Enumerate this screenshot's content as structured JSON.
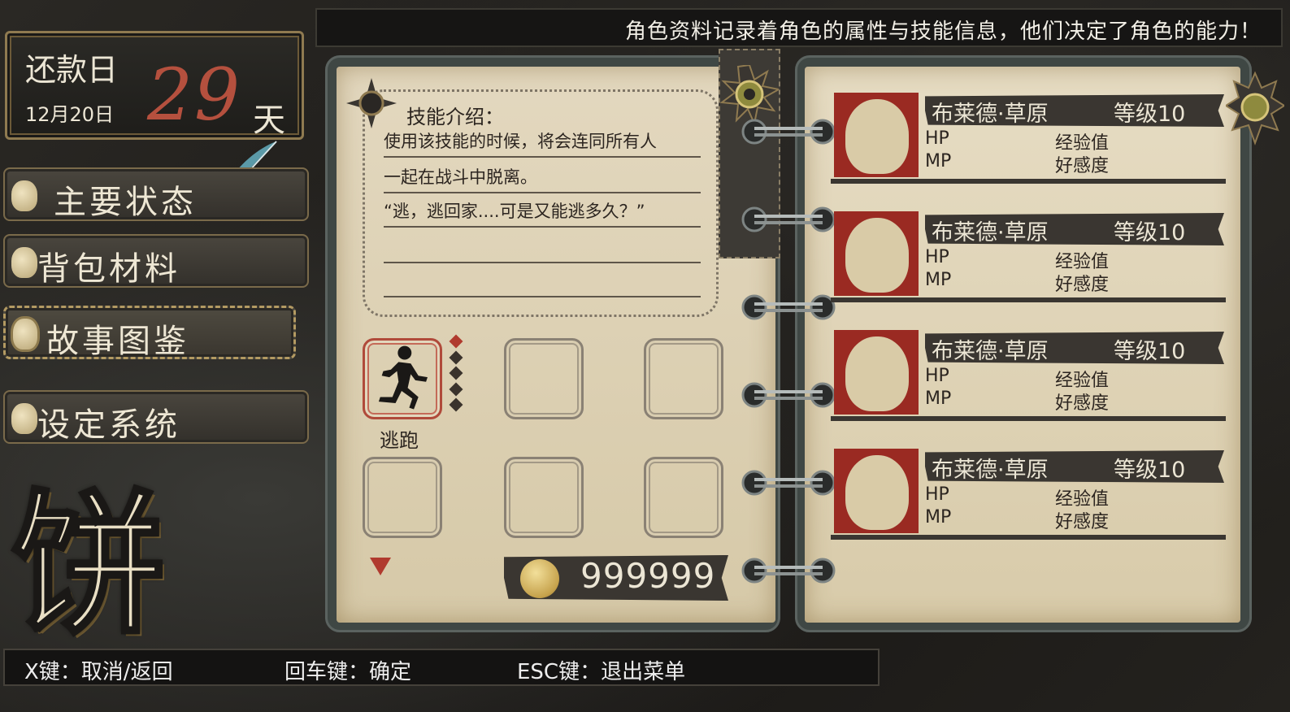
{
  "banner": {
    "text": "角色资料记录着角色的属性与技能信息，他们决定了角色的能力！"
  },
  "date": {
    "label": "还款日",
    "value": "12月20日",
    "days": "29",
    "days_unit": "天"
  },
  "menu": [
    {
      "label": "主要状态"
    },
    {
      "label": "背包材料"
    },
    {
      "label": "故事图鉴"
    },
    {
      "label": "设定系统"
    }
  ],
  "logo_glyph": "饼",
  "skill": {
    "heading": "技能介绍：",
    "lines": [
      "使用该技能的时候，将会连同所有人",
      "一起在战斗中脱离。",
      "“逃，逃回家....可是又能逃多久？”",
      "",
      ""
    ],
    "slot_label": "逃跑"
  },
  "gold": {
    "value": "999999"
  },
  "characters": [
    {
      "name": "布莱德·草原",
      "level": "等级10",
      "hp": "HP",
      "mp": "MP",
      "exp": "经验值",
      "affinity": "好感度"
    },
    {
      "name": "布莱德·草原",
      "level": "等级10",
      "hp": "HP",
      "mp": "MP",
      "exp": "经验值",
      "affinity": "好感度"
    },
    {
      "name": "布莱德·草原",
      "level": "等级10",
      "hp": "HP",
      "mp": "MP",
      "exp": "经验值",
      "affinity": "好感度"
    },
    {
      "name": "布莱德·草原",
      "level": "等级10",
      "hp": "HP",
      "mp": "MP",
      "exp": "经验值",
      "affinity": "好感度"
    }
  ],
  "help": {
    "cancel": "X键：取消/返回",
    "confirm": "回车键：确定",
    "exit": "ESC键：退出菜单"
  },
  "colors": {
    "accent_red": "#b03a2e",
    "portrait_red": "#9a2a22",
    "page": "#e3d8bf",
    "days_red": "#b5503e"
  }
}
